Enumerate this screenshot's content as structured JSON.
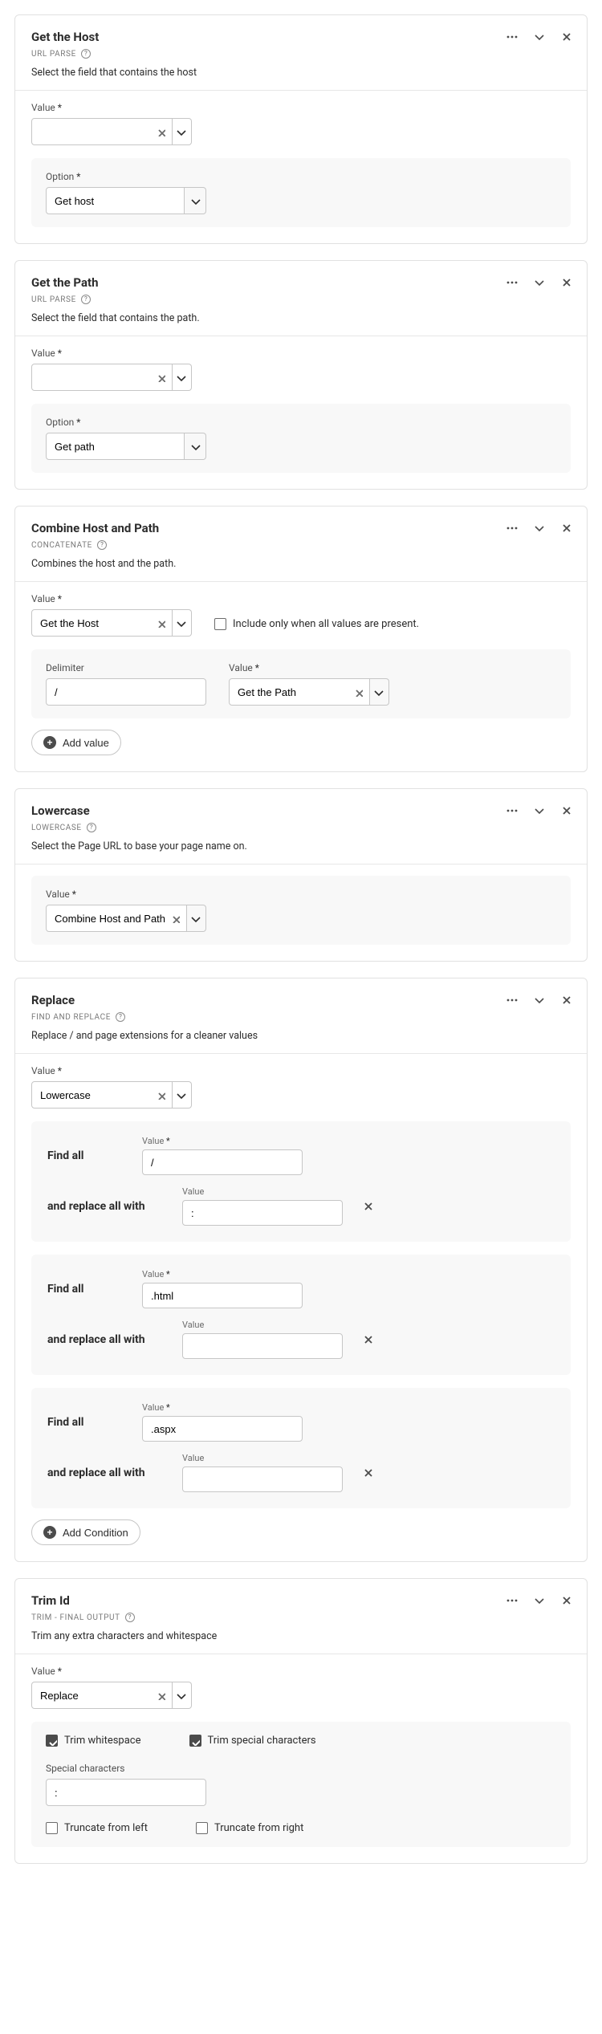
{
  "cards": {
    "host": {
      "title": "Get the Host",
      "subtitle": "URL PARSE",
      "desc": "Select the field that contains the host",
      "valueLabel": "Value",
      "value": "",
      "optionLabel": "Option",
      "option": "Get host"
    },
    "path": {
      "title": "Get the Path",
      "subtitle": "URL PARSE",
      "desc": "Select the field that contains the path.",
      "valueLabel": "Value",
      "value": "",
      "optionLabel": "Option",
      "option": "Get path"
    },
    "combine": {
      "title": "Combine Host and Path",
      "subtitle": "CONCATENATE",
      "desc": "Combines the host and the path.",
      "valueLabel": "Value",
      "value": "Get the Host",
      "includeLabel": "Include only when all values are present.",
      "delimiterLabel": "Delimiter",
      "delimiter": "/",
      "value2Label": "Value",
      "value2": "Get the Path",
      "addBtn": "Add value"
    },
    "lowercase": {
      "title": "Lowercase",
      "subtitle": "LOWERCASE",
      "desc": "Select the Page URL to base your page name on.",
      "valueLabel": "Value",
      "value": "Combine Host and Path"
    },
    "replace": {
      "title": "Replace",
      "subtitle": "FIND AND REPLACE",
      "desc": "Replace / and page extensions for a cleaner values",
      "valueLabel": "Value",
      "value": "Lowercase",
      "findLabel": "Find all",
      "replaceLabel": "and replace all with",
      "colValueLabel": "Value",
      "rules": [
        {
          "find": "/",
          "replace": ":"
        },
        {
          "find": ".html",
          "replace": ""
        },
        {
          "find": ".aspx",
          "replace": ""
        }
      ],
      "addBtn": "Add Condition"
    },
    "trim": {
      "title": "Trim Id",
      "subtitle": "TRIM - FINAL OUTPUT",
      "desc": "Trim any extra characters and whitespace",
      "valueLabel": "Value",
      "value": "Replace",
      "trimWs": "Trim whitespace",
      "trimSc": "Trim special characters",
      "scLabel": "Special characters",
      "sc": ":",
      "truncLeft": "Truncate from left",
      "truncRight": "Truncate from right"
    }
  }
}
